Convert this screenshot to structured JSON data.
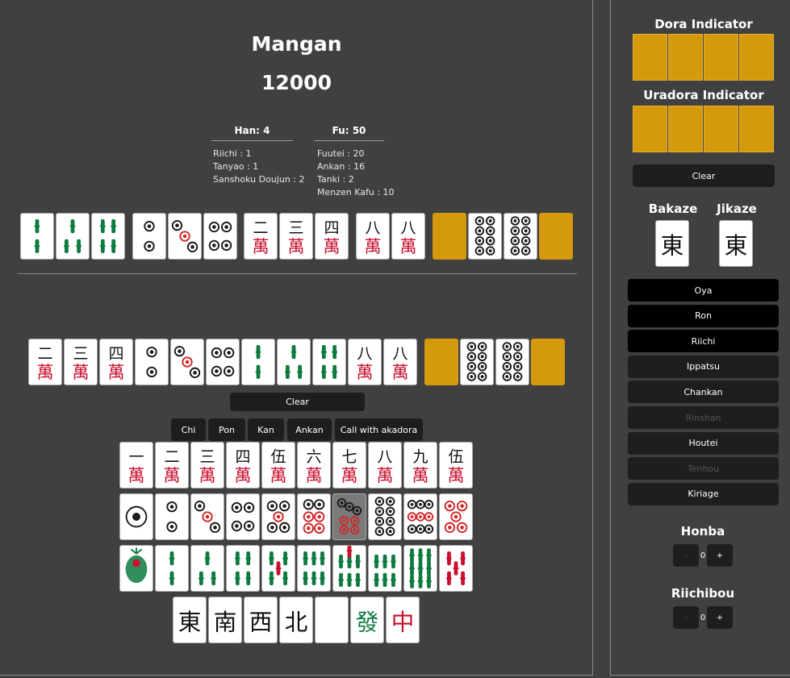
{
  "result": {
    "limit": "Mangan",
    "points": "12000"
  },
  "han": {
    "header": "Han: 4",
    "items": [
      "Riichi : 1",
      "Tanyao : 1",
      "Sanshoku Doujun : 2"
    ]
  },
  "fu": {
    "header": "Fu: 50",
    "items": [
      "Fuutei : 20",
      "Ankan : 16",
      "Tanki : 2",
      "Menzen Kafu : 10"
    ]
  },
  "result_hand": [
    "2s",
    "3s",
    "4s",
    "2p",
    "3p",
    "4p",
    "2m",
    "3m",
    "4m",
    "8m",
    "8m",
    "back",
    "8p",
    "8p",
    "back"
  ],
  "hand": [
    "2m",
    "3m",
    "4m",
    "2p",
    "3p",
    "4p",
    "2s",
    "3s",
    "4s",
    "8m",
    "8m",
    "back",
    "8p",
    "8p",
    "back"
  ],
  "hand_clear": "Clear",
  "call_buttons": [
    "Chi",
    "Pon",
    "Kan",
    "Ankan",
    "Call with akadora"
  ],
  "palette": {
    "man": [
      "1m",
      "2m",
      "3m",
      "4m",
      "5m",
      "6m",
      "7m",
      "8m",
      "9m",
      "5mr"
    ],
    "pin": [
      "1p",
      "2p",
      "3p",
      "4p",
      "5p",
      "6p",
      "7p",
      "8p",
      "9p",
      "5pr"
    ],
    "sou": [
      "1s",
      "2s",
      "3s",
      "4s",
      "5s",
      "6s",
      "7s",
      "8s",
      "9s",
      "5sr"
    ],
    "honor": [
      "E",
      "S",
      "W",
      "N",
      "Wh",
      "G",
      "R"
    ],
    "dimmed": "7p"
  },
  "glyphs": {
    "numerals": {
      "1": "一",
      "2": "二",
      "3": "三",
      "4": "四",
      "5": "伍",
      "6": "六",
      "7": "七",
      "8": "八",
      "9": "九"
    },
    "man": "萬",
    "honors": {
      "E": "東",
      "S": "南",
      "W": "西",
      "N": "北",
      "Wh": "",
      "G": "發",
      "R": "中"
    }
  },
  "dora": {
    "header": "Dora Indicator",
    "count": 4
  },
  "uradora": {
    "header": "Uradora Indicator",
    "count": 4
  },
  "indicator_clear": "Clear",
  "bakaze": {
    "label": "Bakaze",
    "tile": "E"
  },
  "jikaze": {
    "label": "Jikaze",
    "tile": "E"
  },
  "options": [
    {
      "label": "Oya",
      "state": "on"
    },
    {
      "label": "Ron",
      "state": "on"
    },
    {
      "label": "Riichi",
      "state": "on"
    },
    {
      "label": "Ippatsu",
      "state": "normal"
    },
    {
      "label": "Chankan",
      "state": "normal"
    },
    {
      "label": "Rinshan",
      "state": "disabled"
    },
    {
      "label": "Houtei",
      "state": "normal"
    },
    {
      "label": "Tenhou",
      "state": "disabled"
    },
    {
      "label": "Kiriage",
      "state": "normal"
    }
  ],
  "honba": {
    "label": "Honba",
    "minus": "-",
    "value": "0",
    "plus": "+"
  },
  "riichibou": {
    "label": "Riichibou",
    "minus": "-",
    "value": "0",
    "plus": "+"
  },
  "colors": {
    "tile_back": "#d4990c",
    "man_red": "#c8102e",
    "sou_green": "#0d7a3e",
    "pin_dark": "#1a1a1a",
    "pin_red": "#d02828"
  }
}
